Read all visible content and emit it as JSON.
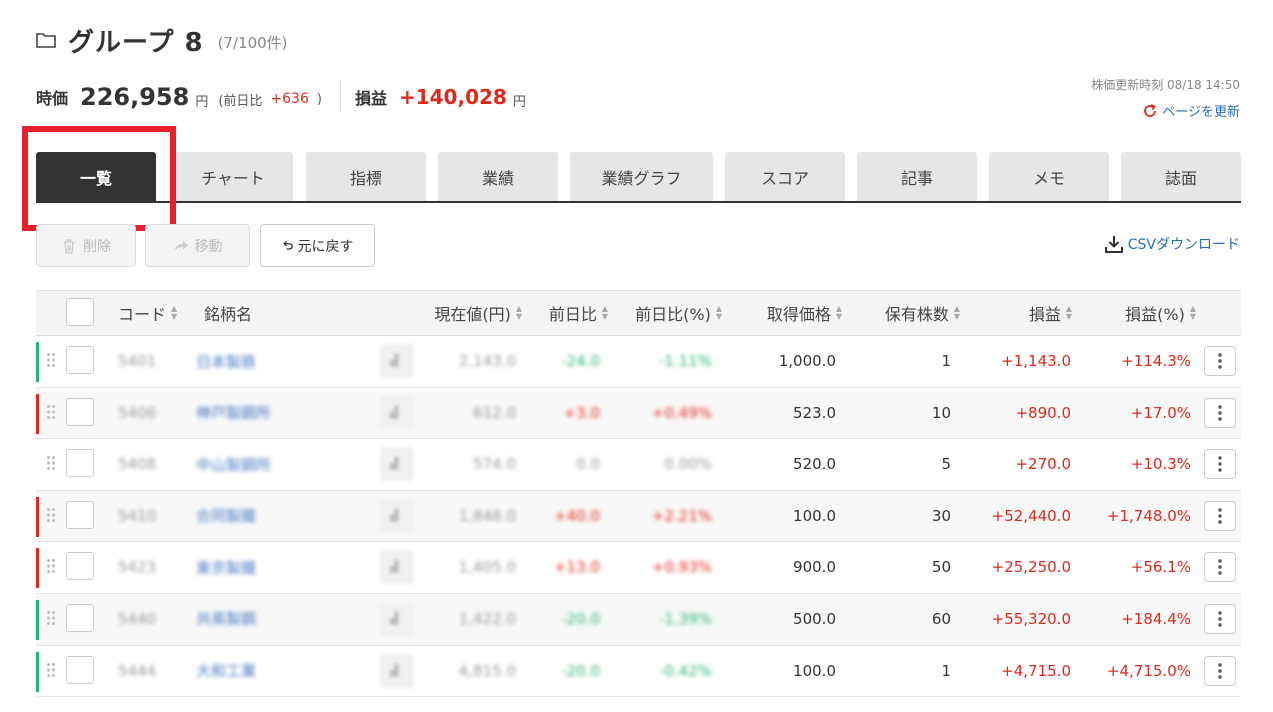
{
  "header": {
    "title": "グループ 8",
    "count": "(7/100件)"
  },
  "summary": {
    "price_label": "時価",
    "price_value": "226,958",
    "price_unit": "円",
    "prev_label": "(前日比",
    "prev_change": "+636",
    "prev_close": ")",
    "pnl_label": "損益",
    "pnl_value": "+140,028",
    "pnl_unit": "円"
  },
  "update": {
    "time": "株価更新時刻 08/18 14:50",
    "refresh_label": "ページを更新"
  },
  "tabs": [
    {
      "label": "一覧",
      "active": true
    },
    {
      "label": "チャート"
    },
    {
      "label": "指標"
    },
    {
      "label": "業績"
    },
    {
      "label": "業績グラフ"
    },
    {
      "label": "スコア"
    },
    {
      "label": "記事"
    },
    {
      "label": "メモ"
    },
    {
      "label": "誌面"
    }
  ],
  "actions": {
    "delete_label": "削除",
    "move_label": "移動",
    "undo_label": "元に戻す",
    "csv_label": "CSVダウンロード"
  },
  "columns": {
    "code": "コード",
    "name": "銘柄名",
    "price": "現在値(円)",
    "change": "前日比",
    "change_pct": "前日比(%)",
    "cost": "取得価格",
    "shares": "保有株数",
    "pnl": "損益",
    "pnl_pct": "損益(%)"
  },
  "rows": [
    {
      "code": "5401",
      "name": "日本製鉄",
      "price": "2,143.0",
      "change": "-24.0",
      "change_pct": "-1.11%",
      "cost": "1,000.0",
      "shares": "1",
      "pnl": "+1,143.0",
      "pnl_pct": "+114.3%",
      "trend": "up"
    },
    {
      "code": "5406",
      "name": "神戸製鋼所",
      "price": "612.0",
      "change": "+3.0",
      "change_pct": "+0.49%",
      "cost": "523.0",
      "shares": "10",
      "pnl": "+890.0",
      "pnl_pct": "+17.0%",
      "trend": "down"
    },
    {
      "code": "5408",
      "name": "中山製鋼所",
      "price": "574.0",
      "change": "0.0",
      "change_pct": "0.00%",
      "cost": "520.0",
      "shares": "5",
      "pnl": "+270.0",
      "pnl_pct": "+10.3%",
      "trend": "none"
    },
    {
      "code": "5410",
      "name": "合同製鐵",
      "price": "1,848.0",
      "change": "+40.0",
      "change_pct": "+2.21%",
      "cost": "100.0",
      "shares": "30",
      "pnl": "+52,440.0",
      "pnl_pct": "+1,748.0%",
      "trend": "down"
    },
    {
      "code": "5423",
      "name": "東京製鐵",
      "price": "1,405.0",
      "change": "+13.0",
      "change_pct": "+0.93%",
      "cost": "900.0",
      "shares": "50",
      "pnl": "+25,250.0",
      "pnl_pct": "+56.1%",
      "trend": "down"
    },
    {
      "code": "5440",
      "name": "共英製鋼",
      "price": "1,422.0",
      "change": "-20.0",
      "change_pct": "-1.39%",
      "cost": "500.0",
      "shares": "60",
      "pnl": "+55,320.0",
      "pnl_pct": "+184.4%",
      "trend": "up"
    },
    {
      "code": "5444",
      "name": "大和工業",
      "price": "4,815.0",
      "change": "-20.0",
      "change_pct": "-0.42%",
      "cost": "100.0",
      "shares": "1",
      "pnl": "+4,715.0",
      "pnl_pct": "+4,715.0%",
      "trend": "up"
    }
  ],
  "colors": {
    "accent_red": "#e0281b",
    "up_green": "#29b473",
    "link_blue": "#2a6db0",
    "active_tab": "#333333",
    "highlight": "#e8202a"
  }
}
